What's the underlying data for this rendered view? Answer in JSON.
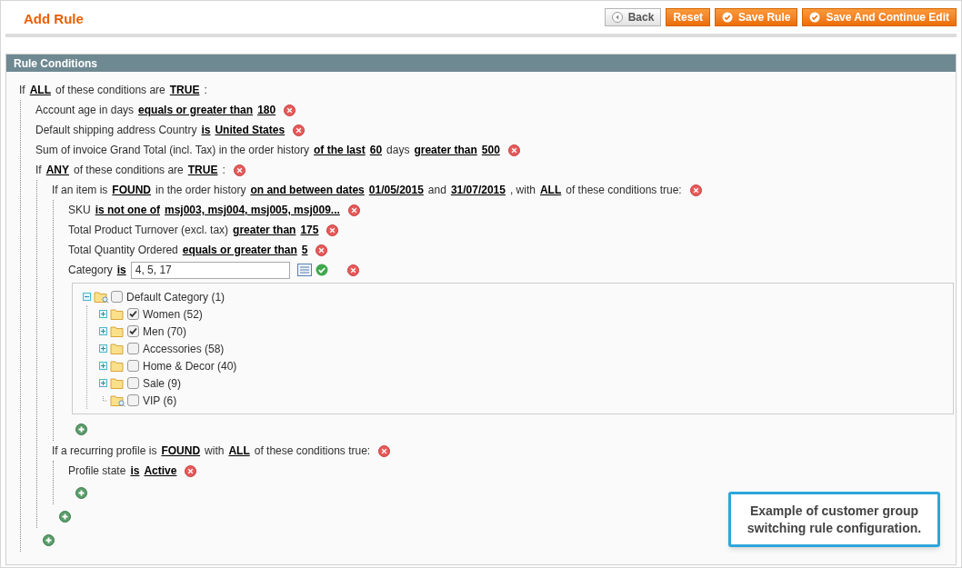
{
  "page": {
    "title": "Add Rule"
  },
  "buttons": [
    {
      "kind": "back",
      "label": "Back"
    },
    {
      "kind": "plain",
      "label": "Reset"
    },
    {
      "kind": "save",
      "label": "Save Rule"
    },
    {
      "kind": "save",
      "label": "Save And Continue Edit"
    }
  ],
  "section": {
    "title": "Rule Conditions"
  },
  "conditions": {
    "kind": "condition",
    "removable": false,
    "parts": [
      {
        "kind": "text",
        "text": "If"
      },
      {
        "kind": "link",
        "text": "ALL"
      },
      {
        "kind": "text",
        "text": "of these conditions are"
      },
      {
        "kind": "link",
        "text": "TRUE"
      },
      {
        "kind": "text",
        "text": ":"
      }
    ],
    "children": [
      {
        "kind": "condition",
        "removable": true,
        "parts": [
          {
            "kind": "text",
            "text": "Account age in days"
          },
          {
            "kind": "link",
            "text": "equals or greater than"
          },
          {
            "kind": "link",
            "text": "180"
          }
        ]
      },
      {
        "kind": "condition",
        "removable": true,
        "parts": [
          {
            "kind": "text",
            "text": "Default shipping address Country"
          },
          {
            "kind": "link",
            "text": "is"
          },
          {
            "kind": "link",
            "text": "United States"
          }
        ]
      },
      {
        "kind": "condition",
        "removable": true,
        "parts": [
          {
            "kind": "text",
            "text": "Sum of invoice Grand Total (incl. Tax) in the order history"
          },
          {
            "kind": "link",
            "text": "of the last"
          },
          {
            "kind": "link",
            "text": "60"
          },
          {
            "kind": "text",
            "text": "days"
          },
          {
            "kind": "link",
            "text": "greater than"
          },
          {
            "kind": "link",
            "text": "500"
          }
        ]
      },
      {
        "kind": "condition",
        "removable": true,
        "parts": [
          {
            "kind": "text",
            "text": "If"
          },
          {
            "kind": "link",
            "text": "ANY"
          },
          {
            "kind": "text",
            "text": "of these conditions are"
          },
          {
            "kind": "link",
            "text": "TRUE"
          },
          {
            "kind": "text",
            "text": ":"
          }
        ],
        "children": [
          {
            "kind": "condition",
            "removable": true,
            "parts": [
              {
                "kind": "text",
                "text": "If an item is"
              },
              {
                "kind": "link",
                "text": "FOUND"
              },
              {
                "kind": "text",
                "text": "in the order history"
              },
              {
                "kind": "link",
                "text": "on and between dates"
              },
              {
                "kind": "link",
                "text": "01/05/2015"
              },
              {
                "kind": "text",
                "text": "and"
              },
              {
                "kind": "link",
                "text": "31/07/2015"
              },
              {
                "kind": "text",
                "text": ", with"
              },
              {
                "kind": "link",
                "text": "ALL"
              },
              {
                "kind": "text",
                "text": "of these conditions true:"
              }
            ],
            "children": [
              {
                "kind": "condition",
                "removable": true,
                "parts": [
                  {
                    "kind": "text",
                    "text": "SKU"
                  },
                  {
                    "kind": "link",
                    "text": "is not one of"
                  },
                  {
                    "kind": "link",
                    "text": "msj003, msj004, msj005, msj009..."
                  }
                ]
              },
              {
                "kind": "condition",
                "removable": true,
                "parts": [
                  {
                    "kind": "text",
                    "text": "Total Product Turnover (excl. tax)"
                  },
                  {
                    "kind": "link",
                    "text": "greater than"
                  },
                  {
                    "kind": "link",
                    "text": "175"
                  }
                ]
              },
              {
                "kind": "condition",
                "removable": true,
                "parts": [
                  {
                    "kind": "text",
                    "text": "Total Quantity Ordered"
                  },
                  {
                    "kind": "link",
                    "text": "equals or greater than"
                  },
                  {
                    "kind": "link",
                    "text": "5"
                  }
                ]
              },
              {
                "kind": "condition",
                "removable": true,
                "parts": [
                  {
                    "kind": "text",
                    "text": "Category"
                  },
                  {
                    "kind": "link",
                    "text": "is"
                  },
                  {
                    "kind": "input",
                    "text": "4, 5, 17"
                  }
                ]
              },
              {
                "kind": "tree",
                "items": [
                  {
                    "label": "Default Category (1)",
                    "kind": "branch",
                    "expanded": true,
                    "checked": false,
                    "children": [
                      {
                        "label": "Women (52)",
                        "kind": "branch",
                        "expanded": false,
                        "checked": true
                      },
                      {
                        "label": "Men (70)",
                        "kind": "branch",
                        "expanded": false,
                        "checked": true
                      },
                      {
                        "label": "Accessories (58)",
                        "kind": "branch",
                        "expanded": false,
                        "checked": false
                      },
                      {
                        "label": "Home & Decor (40)",
                        "kind": "branch",
                        "expanded": false,
                        "checked": false
                      },
                      {
                        "label": "Sale (9)",
                        "kind": "branch",
                        "expanded": false,
                        "checked": false
                      },
                      {
                        "label": "VIP (6)",
                        "kind": "leaf",
                        "checked": false
                      }
                    ]
                  }
                ]
              }
            ]
          },
          {
            "kind": "condition",
            "removable": true,
            "parts": [
              {
                "kind": "text",
                "text": "If a recurring profile is"
              },
              {
                "kind": "link",
                "text": "FOUND"
              },
              {
                "kind": "text",
                "text": "with"
              },
              {
                "kind": "link",
                "text": "ALL"
              },
              {
                "kind": "text",
                "text": "of these conditions true:"
              }
            ],
            "children": [
              {
                "kind": "condition",
                "removable": true,
                "parts": [
                  {
                    "kind": "text",
                    "text": "Profile state"
                  },
                  {
                    "kind": "link",
                    "text": "is"
                  },
                  {
                    "kind": "link",
                    "text": "Active"
                  }
                ]
              }
            ]
          }
        ]
      }
    ]
  },
  "note": "Example of customer group switching rule configuration."
}
